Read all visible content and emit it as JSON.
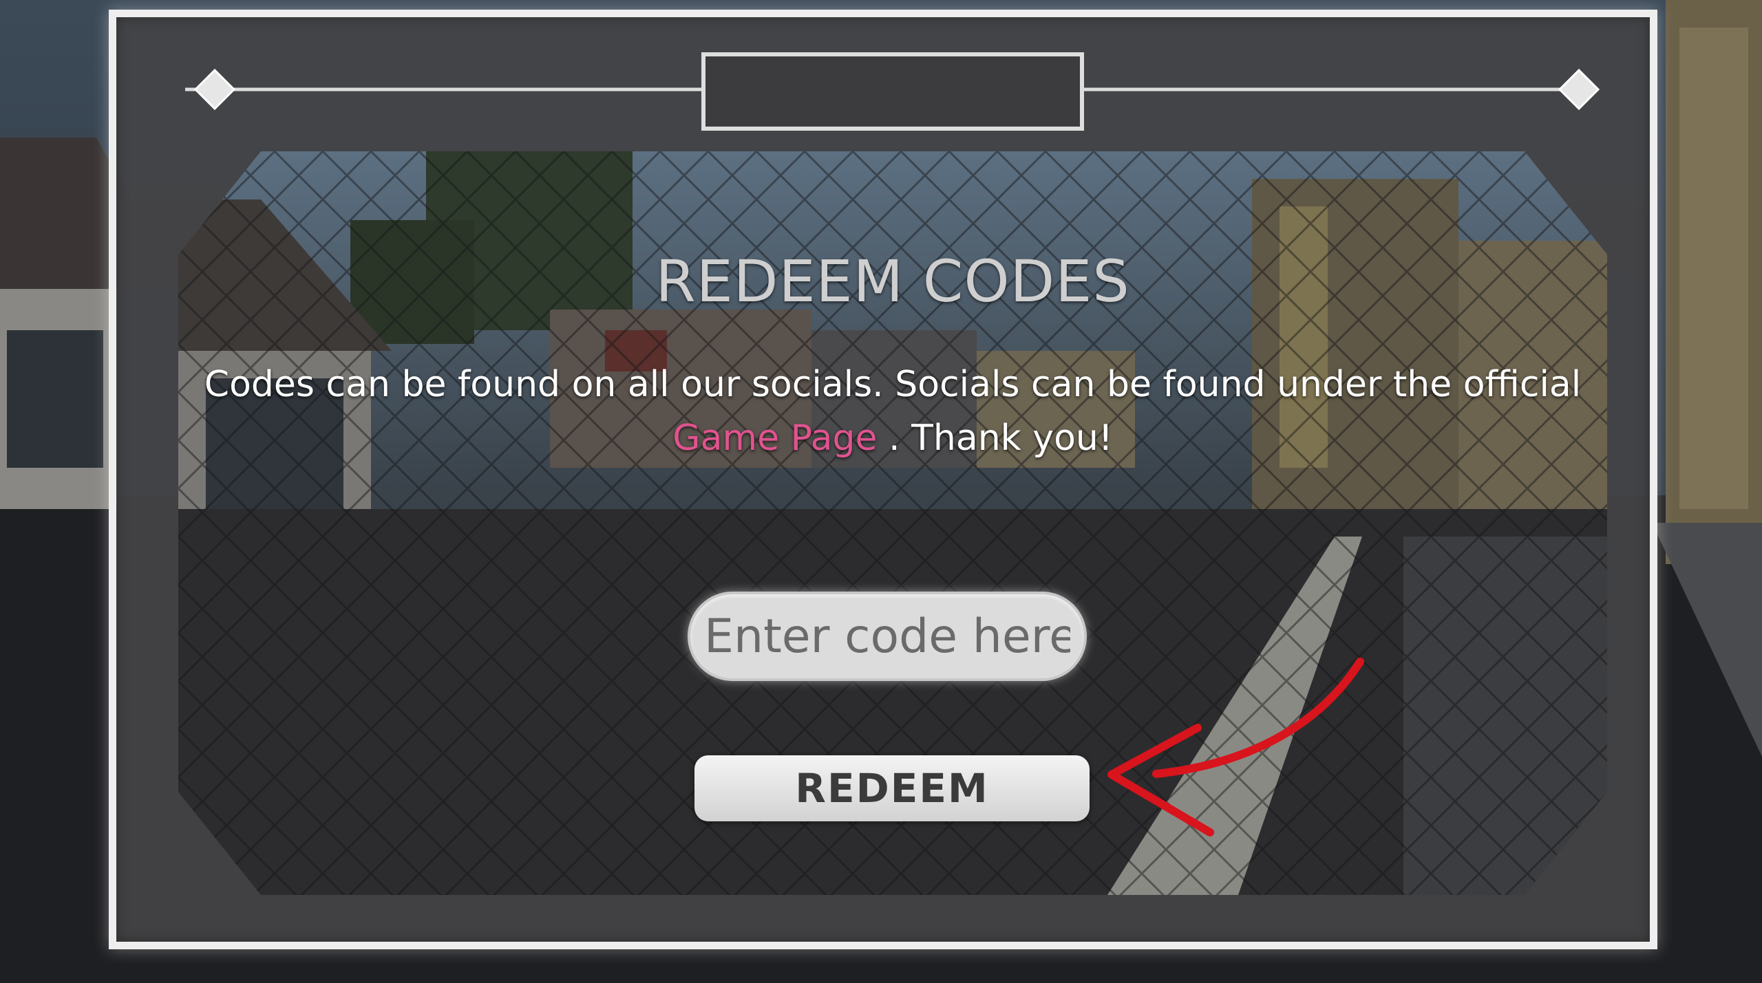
{
  "modal": {
    "title": "REDEEM CODES",
    "description_part1": "Codes can be found on all our socials. Socials can be found under the official ",
    "description_link": "Game Page",
    "description_part2": " . Thank you!",
    "input_placeholder": "Enter code here",
    "redeem_label": "REDEEM"
  },
  "colors": {
    "link": "#e0538f",
    "frame": "#eeeeee",
    "annotation_arrow": "#d8141c"
  }
}
